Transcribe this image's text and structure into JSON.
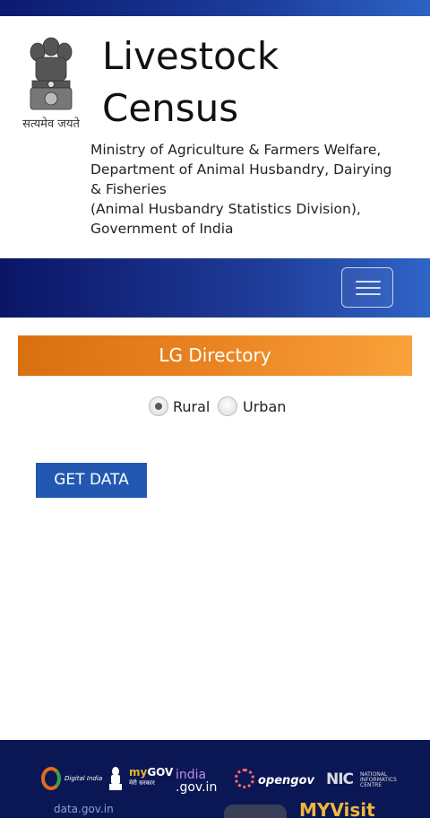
{
  "header": {
    "emblem_motto": "सत्यमेव जयते",
    "title_line1": "Livestock",
    "title_line2": "Census",
    "ministry_lines": [
      "Ministry of Agriculture & Farmers Welfare,",
      "Department of Animal Husbandry, Dairying",
      "& Fisheries",
      "(Animal Husbandry Statistics Division),",
      "Government of India"
    ]
  },
  "navbar": {
    "menu_icon": "hamburger-menu-icon"
  },
  "main": {
    "banner_title": "LG Directory",
    "area_type": {
      "options": [
        "Rural",
        "Urban"
      ],
      "selected": "Rural"
    },
    "get_data_label": "GET DATA"
  },
  "footer": {
    "digital_india": "Digital India",
    "mygov_my": "my",
    "mygov_gov": "GOV",
    "mygov_sub": "मेरी सरकार",
    "india_a": "india",
    "india_b": ".gov.in",
    "opengov": "opengov",
    "nic_big": "NIC",
    "nic_small_1": "NATIONAL",
    "nic_small_2": "INFORMATICS",
    "nic_small_3": "CENTRE",
    "datagov": "data.gov.in",
    "myvisit": "MYVisit"
  },
  "colors": {
    "navbar": "#1f3b98",
    "banner": "#ea8422",
    "button": "#2258b1",
    "footer": "#0b1754"
  }
}
